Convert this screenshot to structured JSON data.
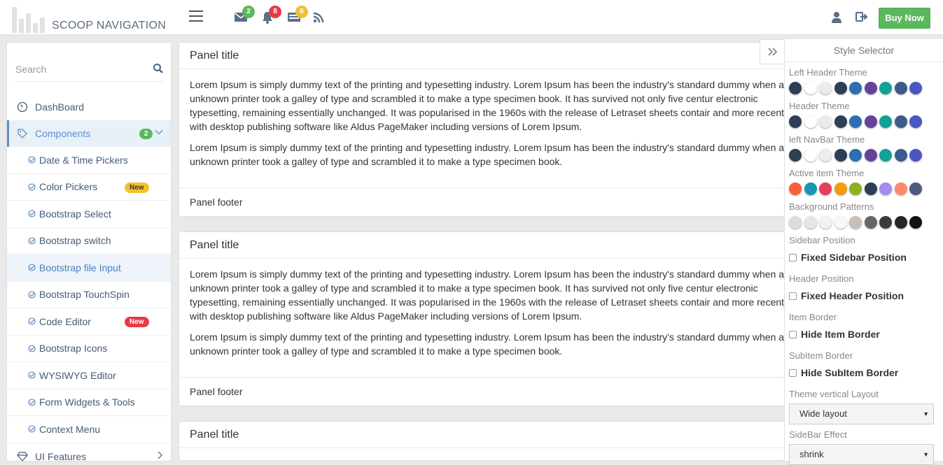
{
  "brand": {
    "name": "SCOOP NAVIGATION"
  },
  "header": {
    "badges": {
      "mail": "2",
      "bell": "8",
      "tasks": "6"
    },
    "buy_now": "Buy Now"
  },
  "sidebar": {
    "search_placeholder": "Search",
    "items": [
      {
        "label": "DashBoard"
      },
      {
        "label": "Components",
        "count": "2"
      }
    ],
    "sub_items": [
      {
        "label": "Date & Time Pickers"
      },
      {
        "label": "Color Pickers",
        "tag": "New"
      },
      {
        "label": "Bootstrap Select"
      },
      {
        "label": "Bootstrap switch"
      },
      {
        "label": "Bootstrap file Input"
      },
      {
        "label": "Bootstrap TouchSpin"
      },
      {
        "label": "Code Editor",
        "tag": "New"
      },
      {
        "label": "Bootstrap Icons"
      },
      {
        "label": "WYSIWYG Editor"
      },
      {
        "label": "Form Widgets & Tools"
      },
      {
        "label": "Context Menu"
      }
    ],
    "after": {
      "label": "UI Features"
    }
  },
  "panels": [
    {
      "title": "Panel title",
      "p1": "Lorem Ipsum is simply dummy text of the printing and typesetting industry. Lorem Ipsum has been the industry's standard dummy when an unknown printer took a galley of type and scrambled it to make a type specimen book. It has survived not only five centur electronic typesetting, remaining essentially unchanged. It was popularised in the 1960s with the release of Letraset sheets contair and more recently with desktop publishing software like Aldus PageMaker including versions of Lorem Ipsum.",
      "p2": "Lorem Ipsum is simply dummy text of the printing and typesetting industry. Lorem Ipsum has been the industry's standard dummy when an unknown printer took a galley of type and scrambled it to make a type specimen book.",
      "footer": "Panel footer"
    },
    {
      "title": "Panel title",
      "p1": "Lorem Ipsum is simply dummy text of the printing and typesetting industry. Lorem Ipsum has been the industry's standard dummy when an unknown printer took a galley of type and scrambled it to make a type specimen book. It has survived not only five centur electronic typesetting, remaining essentially unchanged. It was popularised in the 1960s with the release of Letraset sheets contair and more recently with desktop publishing software like Aldus PageMaker including versions of Lorem Ipsum.",
      "p2": "Lorem Ipsum is simply dummy text of the printing and typesetting industry. Lorem Ipsum has been the industry's standard dummy when an unknown printer took a galley of type and scrambled it to make a type specimen book.",
      "footer": "Panel footer"
    },
    {
      "title": "Panel title"
    }
  ],
  "style_selector": {
    "title": "Style Selector",
    "left_header_theme": "Left Header Theme",
    "header_theme": "Header Theme",
    "left_navbar_theme": "left NavBar Theme",
    "active_item_theme": "Active item Theme",
    "background_patterns": "Background Patterns",
    "sidebar_position": "Sidebar Position",
    "fixed_sidebar": "Fixed Sidebar Position",
    "header_position": "Header Position",
    "fixed_header": "Fixed Header Position",
    "item_border": "Item Border",
    "hide_item_border": "Hide Item Border",
    "subitem_border": "SubItem Border",
    "hide_subitem_border": "Hide SubItem Border",
    "theme_vertical_layout": "Theme vertical Layout",
    "layout_value": "Wide layout",
    "sidebar_effect": "SideBar Effect",
    "effect_value": "shrink",
    "theme_colors": [
      "#2e3e55",
      "#ffffff",
      "#ececec",
      "#2e3e55",
      "#2c6db3",
      "#64449b",
      "#12a196",
      "#3d5a8d",
      "#4b55c4"
    ],
    "active_colors": [
      "#fe5d39",
      "#1497b5",
      "#e43e5c",
      "#f29d0d",
      "#8ab31f",
      "#2e3e55",
      "#a68af0",
      "#fe8a6c",
      "#4c5a80"
    ],
    "pattern_colors": [
      "#dcdcdc",
      "#e6e6e6",
      "#f2f2f2",
      "#f8f8f8",
      "#c8c0b8",
      "#666666",
      "#3a3a3a",
      "#262626",
      "#111111"
    ]
  },
  "colors": {
    "accent": "#5b8fc7",
    "success": "#5cb85c",
    "danger": "#e63b46",
    "warning": "#f3c12f"
  }
}
